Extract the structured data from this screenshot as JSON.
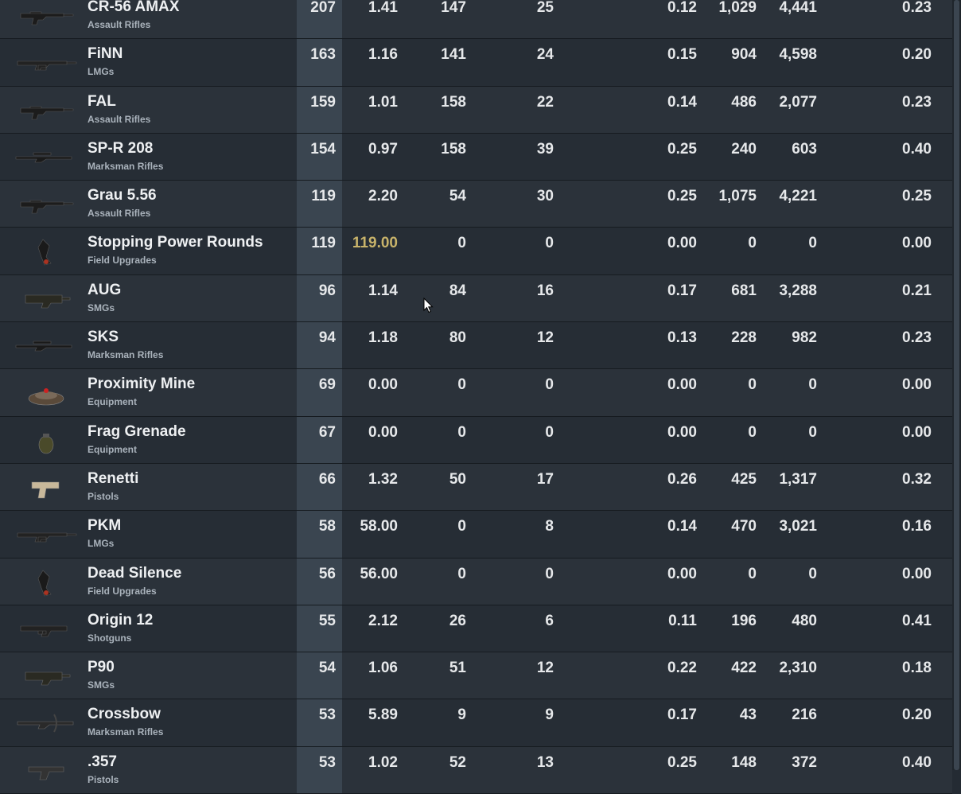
{
  "colors": {
    "background": "#242b33",
    "highlight_column": "#3a4550",
    "gold_value": "#c8b36a"
  },
  "rows": [
    {
      "name": "CR-56 AMAX",
      "category": "Assault Rifles",
      "icon": "assault-rifle-icon",
      "v": [
        "207",
        "1.41",
        "147",
        "25",
        "0.12",
        "1,029",
        "4,441",
        "0.23"
      ]
    },
    {
      "name": "FiNN",
      "category": "LMGs",
      "icon": "lmg-icon",
      "v": [
        "163",
        "1.16",
        "141",
        "24",
        "0.15",
        "904",
        "4,598",
        "0.20"
      ]
    },
    {
      "name": "FAL",
      "category": "Assault Rifles",
      "icon": "assault-rifle-icon",
      "v": [
        "159",
        "1.01",
        "158",
        "22",
        "0.14",
        "486",
        "2,077",
        "0.23"
      ]
    },
    {
      "name": "SP-R 208",
      "category": "Marksman Rifles",
      "icon": "marksman-rifle-icon",
      "v": [
        "154",
        "0.97",
        "158",
        "39",
        "0.25",
        "240",
        "603",
        "0.40"
      ]
    },
    {
      "name": "Grau 5.56",
      "category": "Assault Rifles",
      "icon": "assault-rifle-icon",
      "v": [
        "119",
        "2.20",
        "54",
        "30",
        "0.25",
        "1,075",
        "4,221",
        "0.25"
      ]
    },
    {
      "name": "Stopping Power Rounds",
      "category": "Field Upgrades",
      "icon": "field-upgrade-icon",
      "v": [
        "119",
        "119.00",
        "0",
        "0",
        "0.00",
        "0",
        "0",
        "0.00"
      ],
      "gold": true
    },
    {
      "name": "AUG",
      "category": "SMGs",
      "icon": "smg-icon",
      "v": [
        "96",
        "1.14",
        "84",
        "16",
        "0.17",
        "681",
        "3,288",
        "0.21"
      ]
    },
    {
      "name": "SKS",
      "category": "Marksman Rifles",
      "icon": "marksman-rifle-icon",
      "v": [
        "94",
        "1.18",
        "80",
        "12",
        "0.13",
        "228",
        "982",
        "0.23"
      ]
    },
    {
      "name": "Proximity Mine",
      "category": "Equipment",
      "icon": "proximity-mine-icon",
      "v": [
        "69",
        "0.00",
        "0",
        "0",
        "0.00",
        "0",
        "0",
        "0.00"
      ]
    },
    {
      "name": "Frag Grenade",
      "category": "Equipment",
      "icon": "grenade-icon",
      "v": [
        "67",
        "0.00",
        "0",
        "0",
        "0.00",
        "0",
        "0",
        "0.00"
      ]
    },
    {
      "name": "Renetti",
      "category": "Pistols",
      "icon": "pistol-icon",
      "v": [
        "66",
        "1.32",
        "50",
        "17",
        "0.26",
        "425",
        "1,317",
        "0.32"
      ]
    },
    {
      "name": "PKM",
      "category": "LMGs",
      "icon": "lmg-icon",
      "v": [
        "58",
        "58.00",
        "0",
        "8",
        "0.14",
        "470",
        "3,021",
        "0.16"
      ]
    },
    {
      "name": "Dead Silence",
      "category": "Field Upgrades",
      "icon": "field-upgrade-icon",
      "v": [
        "56",
        "56.00",
        "0",
        "0",
        "0.00",
        "0",
        "0",
        "0.00"
      ]
    },
    {
      "name": "Origin 12",
      "category": "Shotguns",
      "icon": "shotgun-icon",
      "v": [
        "55",
        "2.12",
        "26",
        "6",
        "0.11",
        "196",
        "480",
        "0.41"
      ]
    },
    {
      "name": "P90",
      "category": "SMGs",
      "icon": "smg-icon",
      "v": [
        "54",
        "1.06",
        "51",
        "12",
        "0.22",
        "422",
        "2,310",
        "0.18"
      ]
    },
    {
      "name": "Crossbow",
      "category": "Marksman Rifles",
      "icon": "crossbow-icon",
      "v": [
        "53",
        "5.89",
        "9",
        "9",
        "0.17",
        "43",
        "216",
        "0.20"
      ]
    },
    {
      "name": ".357",
      "category": "Pistols",
      "icon": "revolver-icon",
      "v": [
        "53",
        "1.02",
        "52",
        "13",
        "0.25",
        "148",
        "372",
        "0.40"
      ]
    }
  ]
}
